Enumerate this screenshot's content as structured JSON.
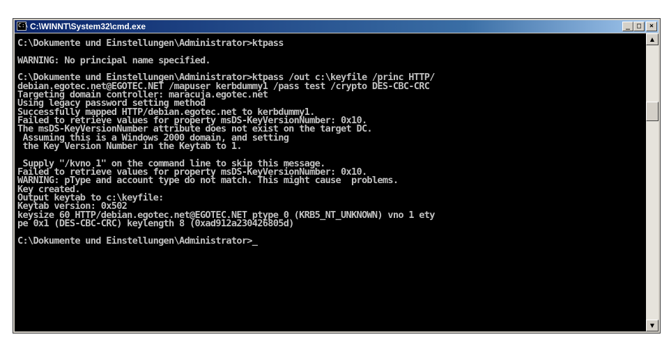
{
  "window": {
    "title": "C:\\WINNT\\System32\\cmd.exe",
    "icon_name": "console-icon",
    "icon_text": "C:\\",
    "controls": {
      "minimize": "_",
      "maximize": "□",
      "close": "×"
    }
  },
  "console": {
    "lines": [
      "C:\\Dokumente und Einstellungen\\Administrator>ktpass",
      "",
      "WARNING: No principal name specified.",
      "",
      "C:\\Dokumente und Einstellungen\\Administrator>ktpass /out c:\\keyfile /princ HTTP/",
      "debian.egotec.net@EGOTEC.NET /mapuser kerbdummy1 /pass test /crypto DES-CBC-CRC",
      "Targeting domain controller: maracuja.egotec.net",
      "Using legacy password setting method",
      "Successfully mapped HTTP/debian.egotec.net to kerbdummy1.",
      "Failed to retrieve values for property msDS-KeyVersionNumber: 0x10.",
      "The msDS-KeyVersionNumber attribute does not exist on the target DC.",
      " Assuming this is a Windows 2000 domain, and setting",
      " the Key Version Number in the Keytab to 1.",
      "",
      " Supply \"/kvno 1\" on the command line to skip this message.",
      "Failed to retrieve values for property msDS-KeyVersionNumber: 0x10.",
      "WARNING: pType and account type do not match. This might cause  problems.",
      "Key created.",
      "Output keytab to c:\\keyfile:",
      "Keytab version: 0x502",
      "keysize 60 HTTP/debian.egotec.net@EGOTEC.NET ptype 0 (KRB5_NT_UNKNOWN) vno 1 ety",
      "pe 0x1 (DES-CBC-CRC) keylength 8 (0xad912a230426805d)",
      "",
      "C:\\Dokumente und Einstellungen\\Administrator>"
    ],
    "cursor": "_"
  },
  "scrollbar": {
    "up_arrow": "▲",
    "down_arrow": "▼"
  },
  "colors": {
    "console_bg": "#000000",
    "console_fg": "#c0c0c0",
    "titlebar_start": "#0a246a",
    "titlebar_end": "#a6caf0"
  }
}
